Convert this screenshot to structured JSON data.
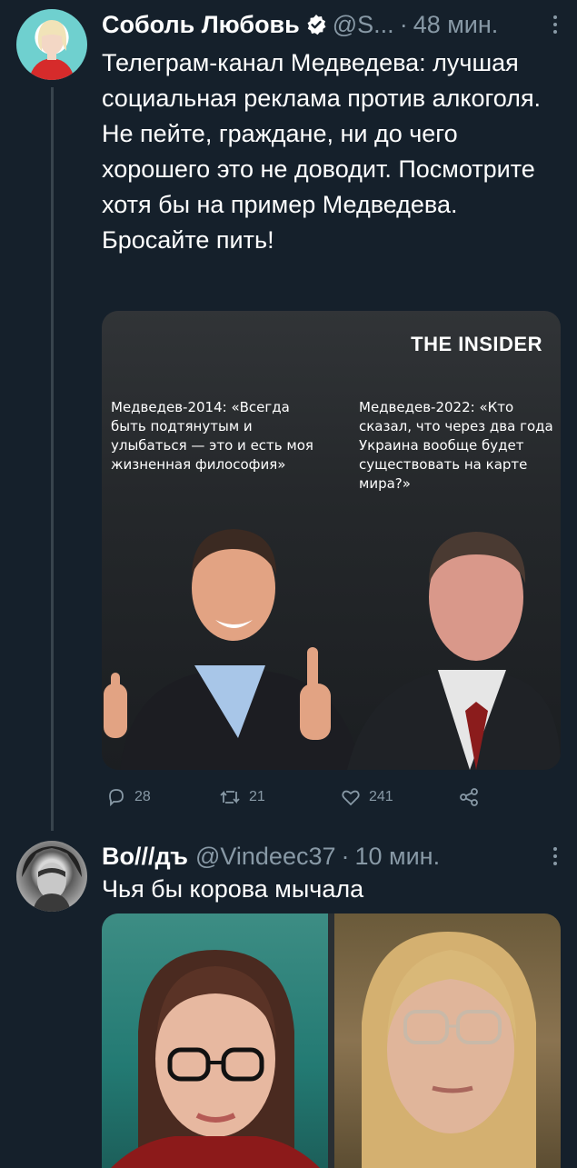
{
  "tweet1": {
    "name": "Соболь Любовь",
    "handle": "@S...",
    "time": "48 мин.",
    "text": "Телеграм-канал Медведева: лучшая социальная реклама против алкоголя. Не пейте, граждане, ни до чего хорошего это не доводит. Посмотрите хотя бы на пример Медведева. Бросайте пить!",
    "media": {
      "brand": "THE INSIDER",
      "quote_left": "Медведев-2014: «Всегда быть подтянутым и улыбаться — это и есть моя жизненная философия»",
      "quote_right": "Медведев-2022: «Кто сказал, что через два года Украина вообще будет существовать на карте мира?»"
    },
    "actions": {
      "replies": "28",
      "retweets": "21",
      "likes": "241"
    }
  },
  "tweet2": {
    "name": "Bo///дъ",
    "handle": "@Vindeec37",
    "time": "10 мин.",
    "text": "Чья бы корова мычала"
  }
}
